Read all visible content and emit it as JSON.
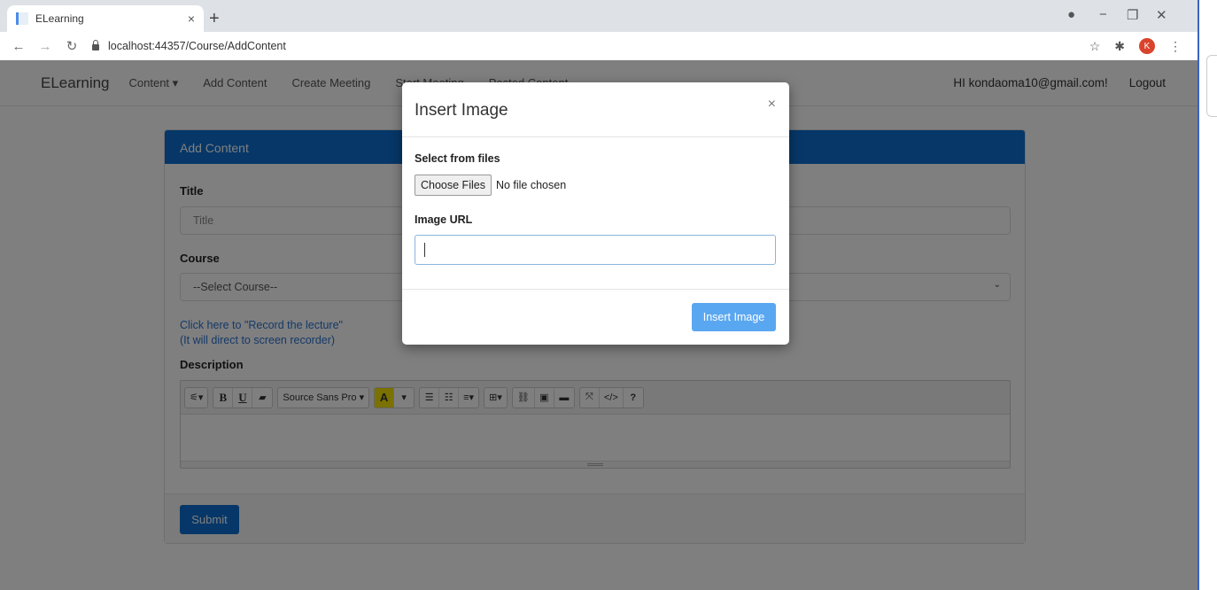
{
  "browser": {
    "tab_title": "ELearning",
    "tab_close": "×",
    "new_tab": "+",
    "url": "localhost:44357/Course/AddContent",
    "profile_initial": "K"
  },
  "nav": {
    "brand": "ELearning",
    "links": [
      "Content ▾",
      "Add Content",
      "Create Meeting",
      "Start Meeting",
      "Posted Content"
    ],
    "greeting": "HI kondaoma10@gmail.com!",
    "logout": "Logout"
  },
  "card": {
    "header": "Add Content",
    "title_label": "Title",
    "title_placeholder": "Title",
    "course_label": "Course",
    "course_selected": "--Select Course--",
    "record_link_line1": "Click here to \"Record the lecture\"",
    "record_link_line2": "(It will direct to screen recorder)",
    "description_label": "Description",
    "font_name": "Source Sans Pro ▾",
    "submit": "Submit"
  },
  "modal": {
    "title": "Insert Image",
    "close": "×",
    "files_label": "Select from files",
    "choose_button": "Choose Files",
    "no_file": "No file chosen",
    "url_label": "Image URL",
    "insert_button": "Insert Image"
  }
}
